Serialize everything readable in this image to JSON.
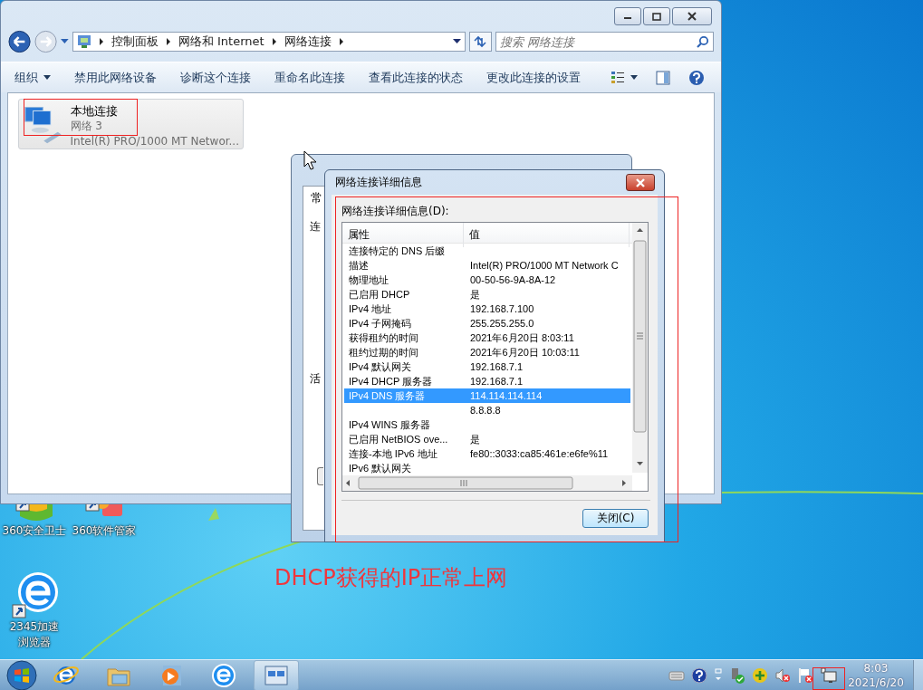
{
  "explorer": {
    "breadcrumb": [
      "控制面板",
      "网络和 Internet",
      "网络连接"
    ],
    "search": {
      "placeholder": "搜索 网络连接"
    },
    "toolbar": [
      {
        "label": "组织",
        "kind": "menu"
      },
      {
        "label": "禁用此网络设备",
        "kind": "plain"
      },
      {
        "label": "诊断这个连接",
        "kind": "plain"
      },
      {
        "label": "重命名此连接",
        "kind": "plain"
      },
      {
        "label": "查看此连接的状态",
        "kind": "plain"
      },
      {
        "label": "更改此连接的设置",
        "kind": "plain"
      }
    ],
    "connections": [
      {
        "name": "本地连接",
        "network": "网络  3",
        "adapter": "Intel(R) PRO/1000 MT Networ..."
      }
    ]
  },
  "status_dialog": {
    "tab_label": "常",
    "labels": [
      "连",
      "活"
    ]
  },
  "details_dialog": {
    "title": "网络连接详细信息",
    "list_label": "网络连接详细信息(D):",
    "columns": [
      "属性",
      "值"
    ],
    "rows": [
      {
        "property": "连接特定的 DNS 后缀",
        "selected": false
      },
      {
        "property": "描述",
        "value": "Intel(R) PRO/1000 MT Network C",
        "selected": false
      },
      {
        "property": "物理地址",
        "value": "00-50-56-9A-8A-12",
        "selected": false
      },
      {
        "property": "已启用 DHCP",
        "value": "是",
        "selected": false
      },
      {
        "property": "IPv4 地址",
        "value": "192.168.7.100",
        "selected": false
      },
      {
        "property": "IPv4 子网掩码",
        "value": "255.255.255.0",
        "selected": false
      },
      {
        "property": "获得租约的时间",
        "value": "2021年6月20日 8:03:11",
        "selected": false
      },
      {
        "property": "租约过期的时间",
        "value": "2021年6月20日 10:03:11",
        "selected": false
      },
      {
        "property": "IPv4 默认网关",
        "value": "192.168.7.1",
        "selected": false
      },
      {
        "property": "IPv4 DHCP 服务器",
        "value": "192.168.7.1",
        "selected": false
      },
      {
        "property": "IPv4 DNS 服务器",
        "value": "114.114.114.114",
        "selected": true
      },
      {
        "value": "8.8.8.8",
        "selected": false
      },
      {
        "property": "IPv4 WINS 服务器",
        "selected": false
      },
      {
        "property": "已启用 NetBIOS ove...",
        "value": "是",
        "selected": false
      },
      {
        "property": "连接-本地 IPv6 地址",
        "value": "fe80::3033:ca85:461e:e6fe%11",
        "selected": false
      },
      {
        "property": "IPv6 默认网关",
        "selected": false
      }
    ],
    "close_button": "关闭(C)"
  },
  "desktop_icons": [
    {
      "label": "360安全卫士",
      "kind": "shield"
    },
    {
      "label": "360软件管家",
      "kind": "box"
    },
    {
      "label": "2345加速浏览器",
      "kind": "browser"
    }
  ],
  "annotation": "DHCP获得的IP正常上网",
  "clock": {
    "time": "8:03",
    "date": "2021/6/20"
  }
}
